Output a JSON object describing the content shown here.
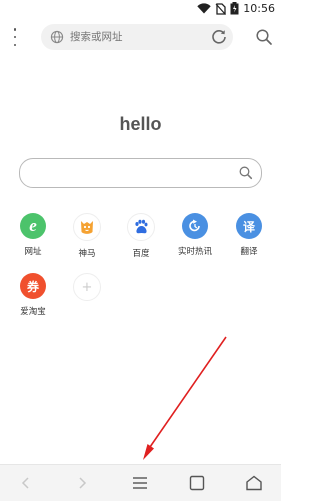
{
  "status_bar": {
    "time": "10:56",
    "icons": [
      "wifi-icon",
      "no-sim-icon",
      "battery-icon"
    ]
  },
  "toolbar": {
    "menu_icon": "more-vertical-icon",
    "address_placeholder": "搜索或网址",
    "reload_icon": "reload-icon",
    "search_icon": "search-icon"
  },
  "main": {
    "greeting": "hello",
    "search_placeholder": ""
  },
  "shortcuts": [
    {
      "label": "网址",
      "glyph": "e",
      "color": "#4cc36b",
      "icon": "web-icon"
    },
    {
      "label": "神马",
      "glyph": "",
      "color": "#ffffff",
      "icon": "shenma-icon"
    },
    {
      "label": "百度",
      "glyph": "",
      "color": "#ffffff",
      "icon": "baidu-paw-icon"
    },
    {
      "label": "实时热讯",
      "glyph": "↺",
      "color": "#4a90e2",
      "icon": "hot-news-icon"
    },
    {
      "label": "翻译",
      "glyph": "译",
      "color": "#4a90e2",
      "icon": "translate-icon"
    },
    {
      "label": "爱淘宝",
      "glyph": "券",
      "color": "#f0502e",
      "icon": "aitaobao-icon"
    },
    {
      "label": "",
      "glyph": "+",
      "color": "#ffffff",
      "icon": "add-shortcut-icon"
    }
  ],
  "bottom_nav": {
    "items": [
      "back-icon",
      "forward-icon",
      "menu-icon",
      "tabs-icon",
      "home-icon"
    ]
  },
  "colors": {
    "annotation_arrow": "#e02020"
  }
}
